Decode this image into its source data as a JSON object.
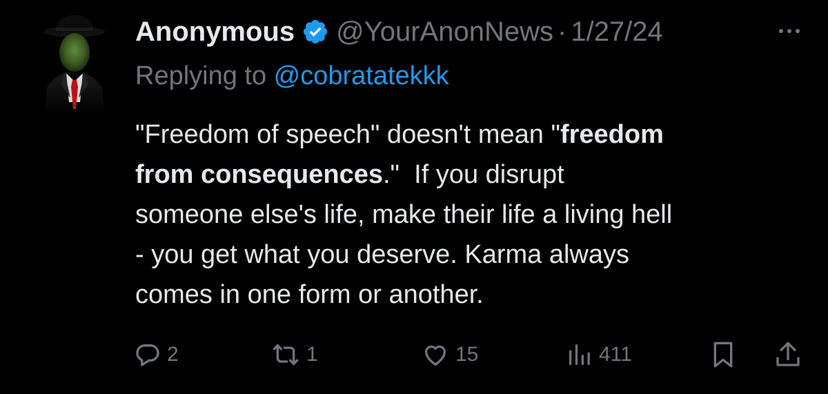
{
  "tweet": {
    "author": {
      "display_name": "Anonymous",
      "handle": "@YourAnonNews",
      "verified": true,
      "verified_icon": "verified-badge-icon"
    },
    "separator": "·",
    "date": "1/27/24",
    "more_icon": "more-options-icon",
    "reply_to": {
      "prefix": "Replying to ",
      "handle": "@cobratatekkk"
    },
    "text": {
      "line1_a": "\"Freedom of speech\" doesn't mean \"",
      "line1_b": "freedom",
      "line2_a": "from consequences",
      "line2_b": ".\"  If you disrupt",
      "line3": "someone else's life, make their life a living hell",
      "line4": "- you get what you deserve. Karma always",
      "line5": "comes in one form or another."
    },
    "actions": {
      "replies": {
        "icon": "reply-icon",
        "count": "2"
      },
      "reposts": {
        "icon": "repost-icon",
        "count": "1"
      },
      "likes": {
        "icon": "like-icon",
        "count": "15"
      },
      "views": {
        "icon": "views-icon",
        "count": "411"
      },
      "bookmark": {
        "icon": "bookmark-icon"
      },
      "share": {
        "icon": "share-icon"
      }
    }
  },
  "colors": {
    "background": "#000000",
    "text_primary": "#e7e9ea",
    "text_secondary": "#71767b",
    "accent_blue": "#1d9bf0"
  }
}
